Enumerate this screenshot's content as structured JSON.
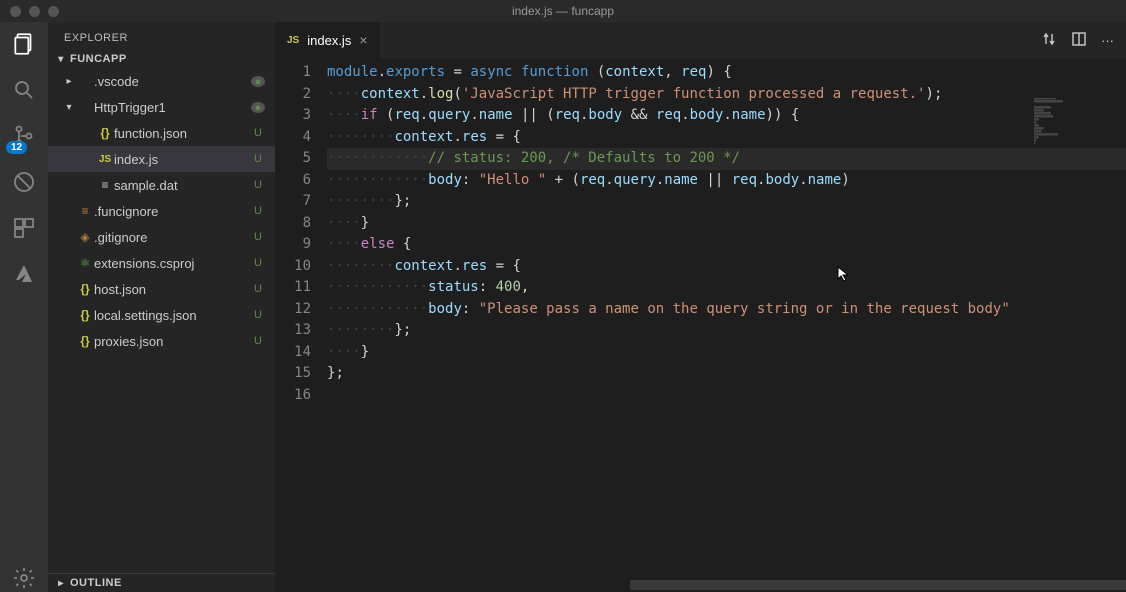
{
  "window": {
    "title": "index.js — funcapp"
  },
  "explorer": {
    "title": "EXPLORER",
    "project": "FUNCAPP",
    "outline": "OUTLINE",
    "items": [
      {
        "indent": 14,
        "twist": "▸",
        "iconCls": "folder",
        "icon": "",
        "label": ".vscode",
        "status": "●",
        "statusCls": "dot"
      },
      {
        "indent": 14,
        "twist": "▾",
        "iconCls": "folder",
        "icon": "",
        "label": "HttpTrigger1",
        "status": "●",
        "statusCls": "dot"
      },
      {
        "indent": 34,
        "twist": "",
        "iconCls": "json",
        "icon": "{}",
        "label": "function.json",
        "status": "U",
        "statusCls": "U"
      },
      {
        "indent": 34,
        "twist": "",
        "iconCls": "js",
        "icon": "JS",
        "label": "index.js",
        "status": "U",
        "statusCls": "U",
        "selected": true
      },
      {
        "indent": 34,
        "twist": "",
        "iconCls": "dat",
        "icon": "≡",
        "label": "sample.dat",
        "status": "U",
        "statusCls": "U"
      },
      {
        "indent": 14,
        "twist": "",
        "iconCls": "ignore",
        "icon": "≡",
        "label": ".funcignore",
        "status": "U",
        "statusCls": "U"
      },
      {
        "indent": 14,
        "twist": "",
        "iconCls": "ignore",
        "icon": "◈",
        "label": ".gitignore",
        "status": "U",
        "statusCls": "U"
      },
      {
        "indent": 14,
        "twist": "",
        "iconCls": "cs",
        "icon": "⚛",
        "label": "extensions.csproj",
        "status": "U",
        "statusCls": "U"
      },
      {
        "indent": 14,
        "twist": "",
        "iconCls": "json",
        "icon": "{}",
        "label": "host.json",
        "status": "U",
        "statusCls": "U"
      },
      {
        "indent": 14,
        "twist": "",
        "iconCls": "json",
        "icon": "{}",
        "label": "local.settings.json",
        "status": "U",
        "statusCls": "U"
      },
      {
        "indent": 14,
        "twist": "",
        "iconCls": "json",
        "icon": "{}",
        "label": "proxies.json",
        "status": "U",
        "statusCls": "U"
      }
    ]
  },
  "scm": {
    "badge": "12"
  },
  "tab": {
    "icon": "JS",
    "label": "index.js"
  },
  "code": {
    "lineCount": 16,
    "lines": [
      "module.exports = async function (context, req) {",
      "    context.log('JavaScript HTTP trigger function processed a request.');",
      "",
      "    if (req.query.name || (req.body && req.body.name)) {",
      "        context.res = {",
      "            // status: 200, /* Defaults to 200 */",
      "            body: \"Hello \" + (req.query.name || req.body.name)",
      "        };",
      "    }",
      "    else {",
      "        context.res = {",
      "            status: 400,",
      "            body: \"Please pass a name on the query string or in the request body\"",
      "        };",
      "    }",
      "};"
    ],
    "highlightedLine": 6
  }
}
